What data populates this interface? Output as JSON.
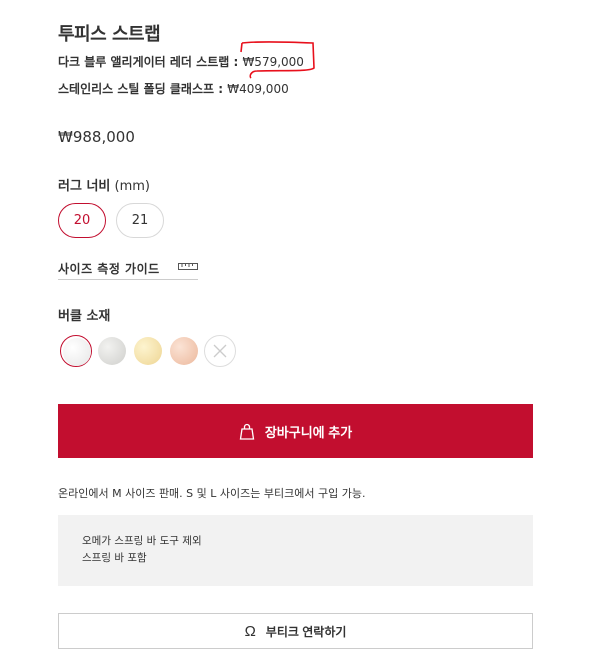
{
  "product": {
    "title": "투피스 스트랩",
    "components": [
      {
        "label": "다크 블루 앨리게이터 레더 스트랩 : ",
        "price": "₩579,000"
      },
      {
        "label": "스테인리스 스틸 폴딩 클래스프 : ",
        "price": "₩409,000"
      }
    ],
    "total_price": "₩988,000"
  },
  "lug_width": {
    "label": "러그 너비",
    "unit": " (mm)",
    "options": [
      "20",
      "21"
    ],
    "selected": "20"
  },
  "size_guide": {
    "label": "사이즈 측정 가이드",
    "icon": "ruler-icon"
  },
  "buckle": {
    "label": "버클 소재",
    "swatches": [
      {
        "name": "stainless-steel",
        "color": "#f4f4f4",
        "selected": true
      },
      {
        "name": "grey",
        "color": "#dcdcda",
        "selected": false
      },
      {
        "name": "yellow-gold",
        "color": "#f5e3a8",
        "selected": false
      },
      {
        "name": "rose-gold",
        "color": "#f3c9b1",
        "selected": false
      },
      {
        "name": "none",
        "color": "#ffffff",
        "selected": false
      }
    ]
  },
  "cart": {
    "label": "장바구니에 추가",
    "icon": "shopping-bag-icon"
  },
  "notice": "온라인에서 M 사이즈 판매. S 및 L 사이즈는 부티크에서 구입 가능.",
  "info": {
    "lines": [
      "오메가 스프링 바 도구 제외",
      "스프링 바 포함"
    ]
  },
  "contact": {
    "label": "부티크 연락하기",
    "icon": "omega-icon"
  },
  "colors": {
    "accent": "#c20e2f",
    "annotation": "#e8101c"
  }
}
